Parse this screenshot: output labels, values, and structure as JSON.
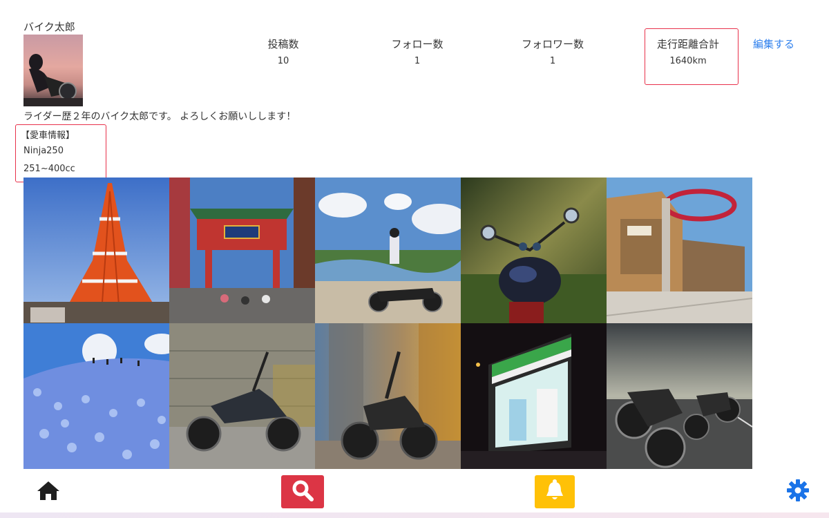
{
  "profile": {
    "username": "バイク太郎",
    "bio": "ライダー歴２年のバイク太郎です。 よろしくお願いしします！",
    "bike_heading": "【愛車情報】",
    "bike_name": "Ninja250",
    "bike_class": "251~400cc",
    "edit_label": "編集する"
  },
  "stats": {
    "posts": {
      "label": "投稿数",
      "value": "10"
    },
    "following": {
      "label": "フォロー数",
      "value": "1"
    },
    "followers": {
      "label": "フォロワー数",
      "value": "1"
    },
    "distance": {
      "label": "走行距離合計",
      "value": "1640km"
    }
  },
  "posts": [
    {
      "subject": "tokyo-tower"
    },
    {
      "subject": "chinatown-gate"
    },
    {
      "subject": "rider-with-motorcycle-overlook"
    },
    {
      "subject": "motorcycle-in-forest"
    },
    {
      "subject": "shopping-mall"
    },
    {
      "subject": "blue-flower-field"
    },
    {
      "subject": "motorcycle-by-wall"
    },
    {
      "subject": "motorcycle-city-street"
    },
    {
      "subject": "convenience-store-night"
    },
    {
      "subject": "two-motorcycles-road"
    }
  ],
  "nav": {
    "home_icon": "home-icon",
    "search_icon": "search-icon",
    "bell_icon": "bell-icon",
    "settings_icon": "gear-icon"
  },
  "colors": {
    "accent_link": "#2f80ed",
    "search_button": "#dc3545",
    "bell_button": "#ffc107",
    "highlight": "#e8304a",
    "settings_icon": "#1a73e8"
  }
}
